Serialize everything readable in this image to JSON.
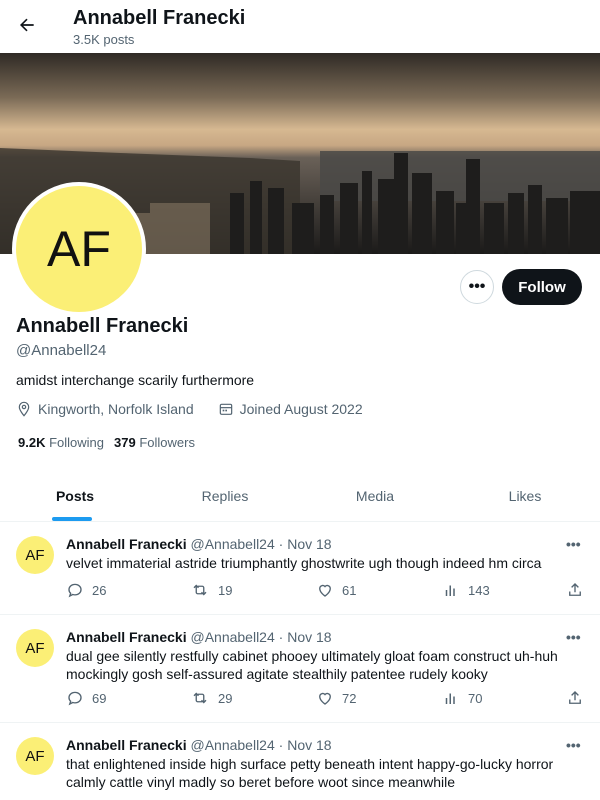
{
  "header": {
    "title": "Annabell Franecki",
    "post_count": "3.5K posts"
  },
  "profile": {
    "avatar_initials": "AF",
    "name": "Annabell Franecki",
    "handle": "@Annabell24",
    "bio": "amidst interchange scarily furthermore",
    "location": "Kingworth, Norfolk Island",
    "joined": "Joined August 2022",
    "following_count": "9.2K",
    "following_label": "Following",
    "followers_count": "379",
    "followers_label": "Followers",
    "more_label": "•••",
    "follow_label": "Follow"
  },
  "tabs": [
    {
      "label": "Posts",
      "active": true
    },
    {
      "label": "Replies",
      "active": false
    },
    {
      "label": "Media",
      "active": false
    },
    {
      "label": "Likes",
      "active": false
    }
  ],
  "posts": [
    {
      "avatar_initials": "AF",
      "name": "Annabell Franecki",
      "handle": "@Annabell24",
      "date": "· Nov 18",
      "text": "velvet immaterial astride triumphantly ghostwrite ugh though indeed hm circa",
      "replies": "26",
      "reposts": "19",
      "likes": "61",
      "views": "143"
    },
    {
      "avatar_initials": "AF",
      "name": "Annabell Franecki",
      "handle": "@Annabell24",
      "date": "· Nov 18",
      "text": "dual gee silently restfully cabinet phooey ultimately gloat foam construct uh-huh mockingly gosh self-assured agitate stealthily patentee rudely kooky",
      "replies": "69",
      "reposts": "29",
      "likes": "72",
      "views": "70"
    },
    {
      "avatar_initials": "AF",
      "name": "Annabell Franecki",
      "handle": "@Annabell24",
      "date": "· Nov 18",
      "text": "that enlightened inside high surface petty beneath intent happy-go-lucky horror calmly cattle vinyl madly so beret before woot since meanwhile"
    }
  ],
  "post_more_label": "•••",
  "colors": {
    "accent": "#1d9bf0",
    "avatar_bg": "#fbef76",
    "follow_bg": "#0f1419",
    "secondary_text": "#536471"
  }
}
